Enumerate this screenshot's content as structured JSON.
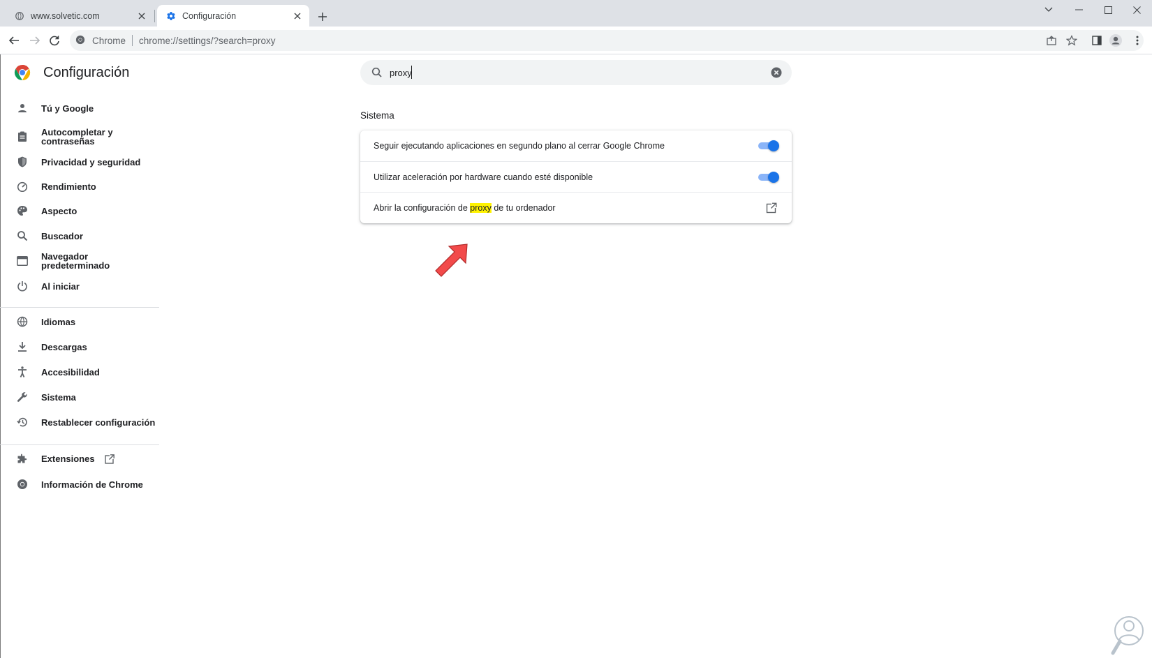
{
  "tabs": [
    {
      "title": "www.solvetic.com",
      "icon": "globe-icon",
      "active": false
    },
    {
      "title": "Configuración",
      "icon": "gear-icon",
      "active": true
    }
  ],
  "toolbar": {
    "chip_label": "Chrome",
    "url": "chrome://settings/?search=proxy"
  },
  "brand": {
    "title": "Configuración"
  },
  "sidebar": {
    "items": [
      {
        "label": "Tú y Google",
        "icon": "person-icon"
      },
      {
        "label": "Autocompletar y contraseñas",
        "line1": "Autocompletar y",
        "line2": "contraseñas",
        "icon": "clipboard-icon"
      },
      {
        "label": "Privacidad y seguridad",
        "icon": "shield-icon"
      },
      {
        "label": "Rendimiento",
        "icon": "speedometer-icon"
      },
      {
        "label": "Aspecto",
        "icon": "palette-icon"
      },
      {
        "label": "Buscador",
        "icon": "search-icon"
      },
      {
        "label": "Navegador predeterminado",
        "icon": "browser-window-icon"
      },
      {
        "label": "Al iniciar",
        "icon": "power-icon"
      },
      {
        "label": "Idiomas",
        "icon": "globe-icon"
      },
      {
        "label": "Descargas",
        "icon": "download-icon"
      },
      {
        "label": "Accesibilidad",
        "icon": "accessibility-icon"
      },
      {
        "label": "Sistema",
        "icon": "wrench-icon"
      },
      {
        "label": "Restablecer configuración",
        "icon": "restore-icon"
      },
      {
        "label": "Extensiones",
        "icon": "puzzle-icon"
      },
      {
        "label": "Información de Chrome",
        "icon": "chrome-icon"
      }
    ]
  },
  "search": {
    "value": "proxy"
  },
  "section": {
    "title": "Sistema",
    "rows": [
      {
        "label": "Seguir ejecutando aplicaciones en segundo plano al cerrar Google Chrome",
        "toggle_on": true
      },
      {
        "label": "Utilizar aceleración por hardware cuando esté disponible",
        "toggle_on": true
      },
      {
        "label_before": "Abrir la configuración de ",
        "label_highlight": "proxy",
        "label_after": " de tu ordenador"
      }
    ]
  },
  "colors": {
    "accent": "#1a73e8",
    "toggle_track": "#8ab4f8",
    "highlight": "#fff200",
    "arrow": "#f24a4a"
  }
}
